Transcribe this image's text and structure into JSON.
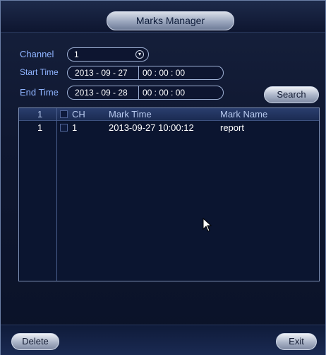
{
  "window": {
    "title": "Marks Manager"
  },
  "filters": {
    "channel_label": "Channel",
    "channel_value": "1",
    "start_label": "Start Time",
    "start_date": "2013 - 09 - 27",
    "start_time": "00 : 00 : 00",
    "end_label": "End Time",
    "end_date": "2013 - 09 - 28",
    "end_time": "00 : 00 : 00",
    "search_label": "Search"
  },
  "table": {
    "headers": {
      "index": "1",
      "ch": "CH",
      "mark_time": "Mark Time",
      "mark_name": "Mark Name"
    },
    "rows": [
      {
        "index": "1",
        "ch": "1",
        "mark_time": "2013-09-27 10:00:12",
        "mark_name": "report"
      }
    ]
  },
  "actions": {
    "delete_label": "Delete",
    "exit_label": "Exit"
  },
  "icons": {
    "dropdown": "chevron-down-icon",
    "cursor": "mouse-pointer-icon"
  }
}
